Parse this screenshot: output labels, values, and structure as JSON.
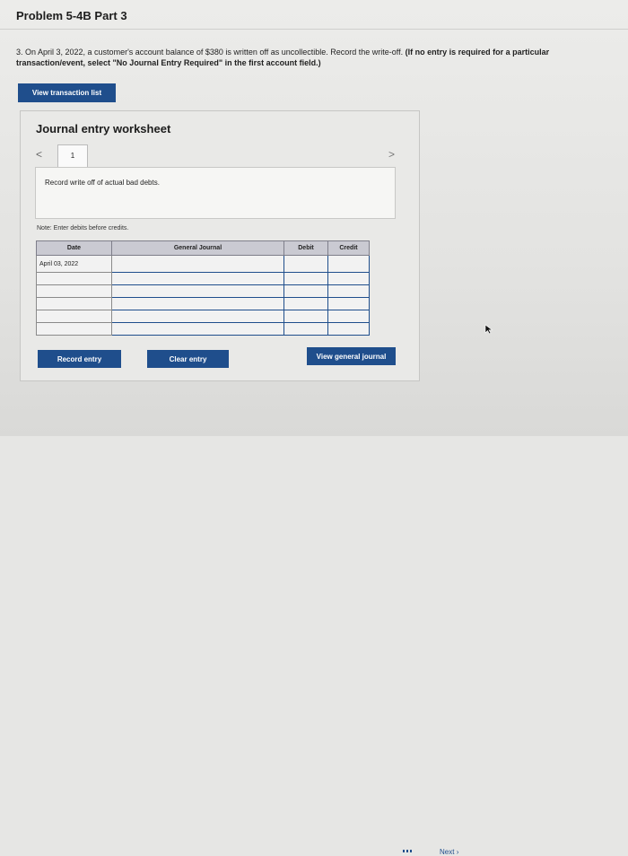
{
  "header": {
    "title": "Problem 5-4B Part 3"
  },
  "question": {
    "text": "3. On April 3, 2022, a customer's account balance of $380 is written off as uncollectible. Record the write-off.",
    "instruction": "(If no entry is required for a particular transaction/event, select \"No Journal Entry Required\" in the first account field.)"
  },
  "buttons": {
    "view_transactions": "View transaction list",
    "record_entry": "Record entry",
    "clear_entry": "Clear entry",
    "view_general_journal": "View general journal"
  },
  "worksheet": {
    "title": "Journal entry worksheet",
    "nav_prev": "<",
    "nav_next": ">",
    "tab_number": "1",
    "description": "Record write off of actual bad debts.",
    "note": "Note: Enter debits before credits."
  },
  "journal": {
    "headers": [
      "Date",
      "General Journal",
      "Debit",
      "Credit"
    ],
    "rows": [
      {
        "date": "April 03, 2022",
        "account": "",
        "debit": "",
        "credit": ""
      },
      {
        "date": "",
        "account": "",
        "debit": "",
        "credit": ""
      },
      {
        "date": "",
        "account": "",
        "debit": "",
        "credit": ""
      },
      {
        "date": "",
        "account": "",
        "debit": "",
        "credit": ""
      },
      {
        "date": "",
        "account": "",
        "debit": "",
        "credit": ""
      },
      {
        "date": "",
        "account": "",
        "debit": "",
        "credit": ""
      }
    ]
  },
  "footer": {
    "next": "Next"
  },
  "colors": {
    "accent": "#1f4e8c",
    "table_header": "#cacad2"
  }
}
